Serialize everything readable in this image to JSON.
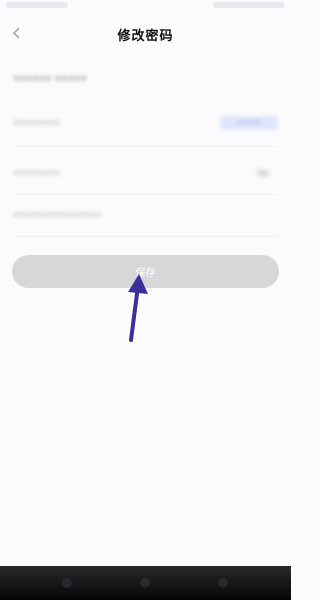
{
  "status_bar": {
    "left_text": "",
    "right_text": ""
  },
  "nav": {
    "title": "修改密码",
    "back_icon": "back-arrow-icon"
  },
  "form": {
    "heading": "••••••  •••••",
    "fields": [
      {
        "label": "••••••••",
        "action": "•••••"
      },
      {
        "label": "••••••••",
        "action_icon": "eye-icon"
      },
      {
        "label": "•••••••••••••••"
      }
    ]
  },
  "save_button": {
    "label": "保存",
    "background": "#d7d7da",
    "text_color": "#ffffff"
  },
  "annotation": {
    "arrow_color": "#3b2f9a"
  }
}
